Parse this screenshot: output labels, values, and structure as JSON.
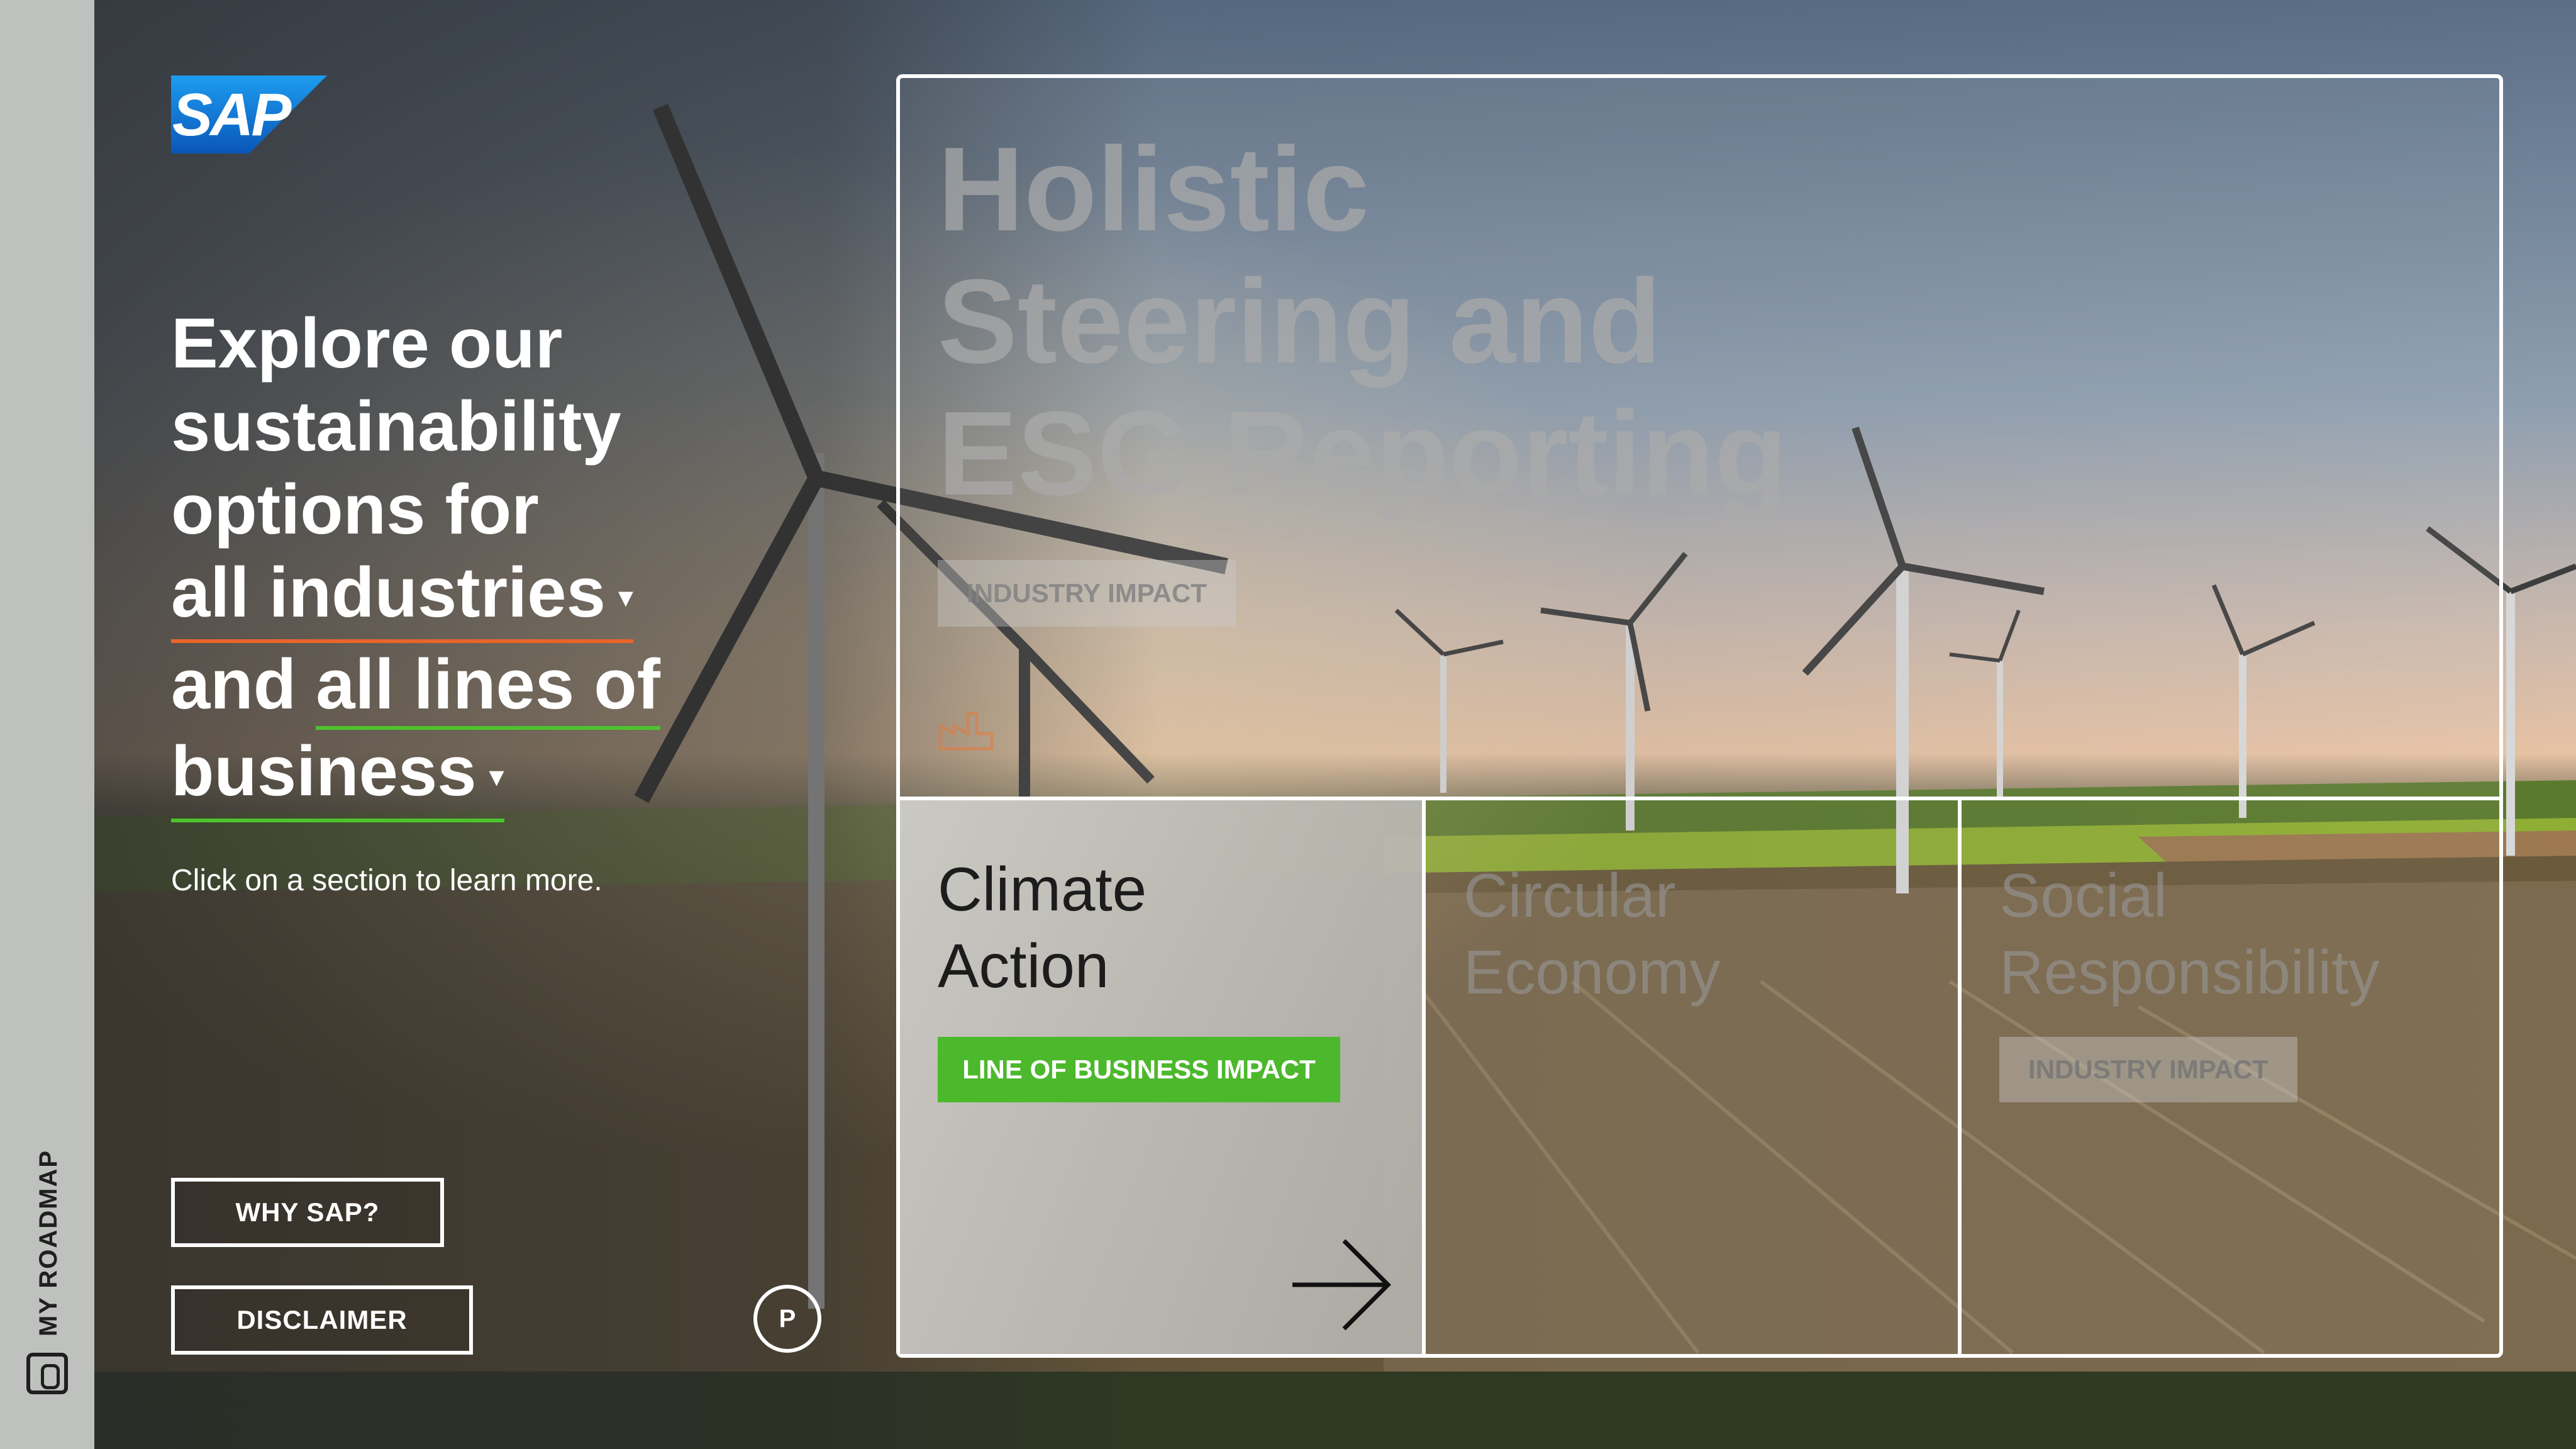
{
  "rail": {
    "label": "MY ROADMAP",
    "icon": "phone-icon"
  },
  "brand": {
    "logo_text": "SAP",
    "logo_color_top": "#1d9cf0",
    "logo_color_bottom": "#0a57b8"
  },
  "headline": {
    "line1": "Explore our",
    "line2": "sustainability",
    "line3": "options for",
    "industries_dropdown": "all industries",
    "and_text": "and",
    "lines_of_text": "all lines of",
    "business_dropdown": "business",
    "caret": "▾",
    "underline_orange": "#e8652a",
    "underline_green": "#4cc42c"
  },
  "hint": "Click on a section to learn more.",
  "buttons": {
    "why_sap": "WHY SAP?",
    "disclaimer": "DISCLAIMER",
    "p_badge": "P"
  },
  "tiles": {
    "holistic": {
      "title_line1": "Holistic",
      "title_line2": "Steering and",
      "title_line3": "ESG Reporting",
      "tag": "INDUSTRY IMPACT",
      "icon": "factory-icon"
    },
    "climate": {
      "title_line1": "Climate",
      "title_line2": "Action",
      "tag": "LINE OF BUSINESS IMPACT",
      "tag_color": "#4cb82c",
      "icon": "arrow-right-icon"
    },
    "circular": {
      "title_line1": "Circular",
      "title_line2": "Economy"
    },
    "social": {
      "title_line1": "Social",
      "title_line2": "Responsibility",
      "tag": "INDUSTRY IMPACT"
    }
  }
}
